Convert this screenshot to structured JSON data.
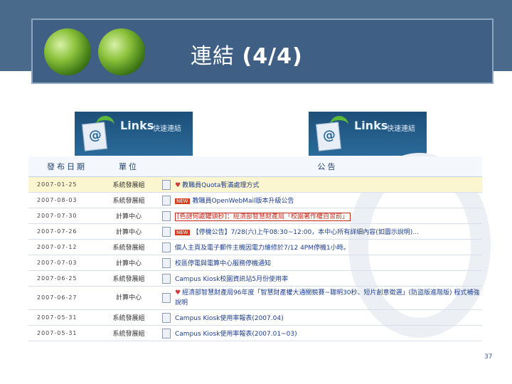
{
  "title": {
    "text": "連結",
    "suffix": "(4/4)"
  },
  "banners": [
    {
      "logo_text": "Links",
      "sub_text": "快速連結"
    },
    {
      "logo_text": "Links",
      "sub_text": "快速連結"
    }
  ],
  "table": {
    "headers": {
      "date": "發布日期",
      "unit": "單位",
      "title": "公告"
    },
    "rows": [
      {
        "date": "2007-01-25",
        "unit": "系統發展組",
        "title": "教職員Quota暫滿處理方式",
        "badge": "heart"
      },
      {
        "date": "2007-08-03",
        "unit": "系統發展組",
        "title": "教職員OpenWebMail版本升級公告",
        "badge": "new"
      },
      {
        "date": "2007-07-30",
        "unit": "計算中心",
        "title": "[色謎何處罐頭秒]：經濟部智慧財產局「校園著作權自習前」",
        "badge": "boxed"
      },
      {
        "date": "2007-07-26",
        "unit": "計算中心",
        "title": "【停機公告】7/28(六)上午08:30~12:00，本中心所有詳細內容(如圖示說明)...",
        "badge": "new"
      },
      {
        "date": "2007-07-12",
        "unit": "系統發展組",
        "title": "個人主頁及電子郵件主機因電力維修於7/12 4PM停機1小時。",
        "badge": "none"
      },
      {
        "date": "2007-07-03",
        "unit": "計算中心",
        "title": "校區停電與電算中心服務停機通知",
        "badge": "none"
      },
      {
        "date": "2007-06-25",
        "unit": "系統發展組",
        "title": "Campus Kiosk校園資訊站5月份使用率",
        "badge": "none"
      },
      {
        "date": "2007-06-27",
        "unit": "計算中心",
        "title": "經濟部智慧財產局96年度「智慧財產權大通關競賽~聰明30秒、短片創意徵選」(防盜版進階版) 程式補強說明",
        "badge": "heart"
      },
      {
        "date": "2007-05-31",
        "unit": "系統發展組",
        "title": "Campus Kiosk使用率報表(2007.04)",
        "badge": "none"
      },
      {
        "date": "2007-05-31",
        "unit": "系統發展組",
        "title": "Campus Kiosk使用率報表(2007.01~03)",
        "badge": "none"
      }
    ]
  },
  "page_number": "37"
}
